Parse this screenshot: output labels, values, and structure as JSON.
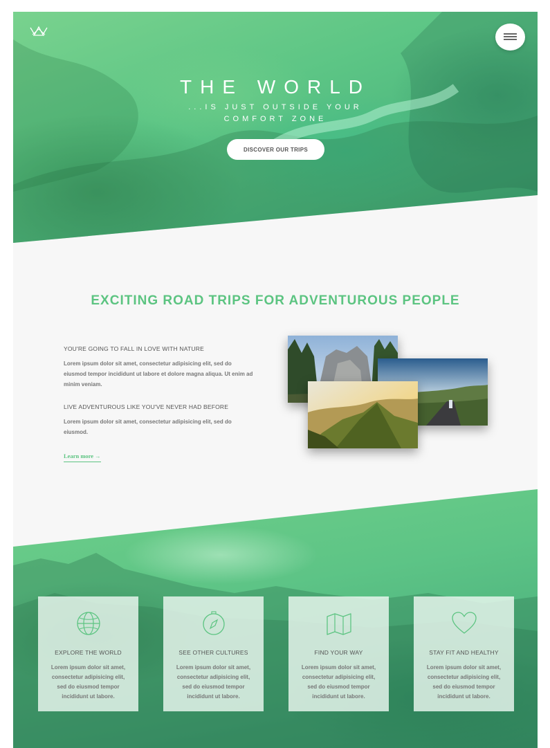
{
  "hero": {
    "title": "THE WORLD",
    "subtitle": "...IS JUST OUTSIDE YOUR COMFORT ZONE",
    "cta_label": "DISCOVER OUR TRIPS",
    "logo_icon": "crown-icon",
    "menu_icon": "hamburger-icon"
  },
  "intro": {
    "heading": "EXCITING ROAD TRIPS FOR ADVENTUROUS PEOPLE",
    "features": [
      {
        "title": "YOU'RE GOING TO FALL IN LOVE WITH NATURE",
        "text": "Lorem ipsum dolor sit amet, consectetur adipisicing elit, sed do eiusmod tempor incididunt ut labore et dolore magna aliqua. Ut enim ad minim veniam."
      },
      {
        "title": "LIVE ADVENTUROUS LIKE YOU'VE NEVER HAD BEFORE",
        "text": "Lorem ipsum dolor sit amet, consectetur adipisicing elit, sed do eiusmod."
      }
    ],
    "link_label": "Learn more →"
  },
  "cards": [
    {
      "icon": "globe-icon",
      "title": "EXPLORE THE WORLD",
      "text": "Lorem ipsum dolor sit amet, consectetur adipisicing elit, sed do eiusmod tempor incididunt ut labore."
    },
    {
      "icon": "compass-icon",
      "title": "SEE OTHER CULTURES",
      "text": "Lorem ipsum dolor sit amet, consectetur adipisicing elit, sed do eiusmod tempor incididunt ut labore."
    },
    {
      "icon": "map-icon",
      "title": "FIND YOUR WAY",
      "text": "Lorem ipsum dolor sit amet, consectetur adipisicing elit, sed do eiusmod tempor incididunt ut labore."
    },
    {
      "icon": "heart-icon",
      "title": "STAY FIT AND HEALTHY",
      "text": "Lorem ipsum dolor sit amet, consectetur adipisicing elit, sed do eiusmod tempor incididunt ut labore."
    }
  ],
  "colors": {
    "accent": "#5cc481",
    "hero_green": "#5cc585",
    "background": "#f7f7f7"
  }
}
